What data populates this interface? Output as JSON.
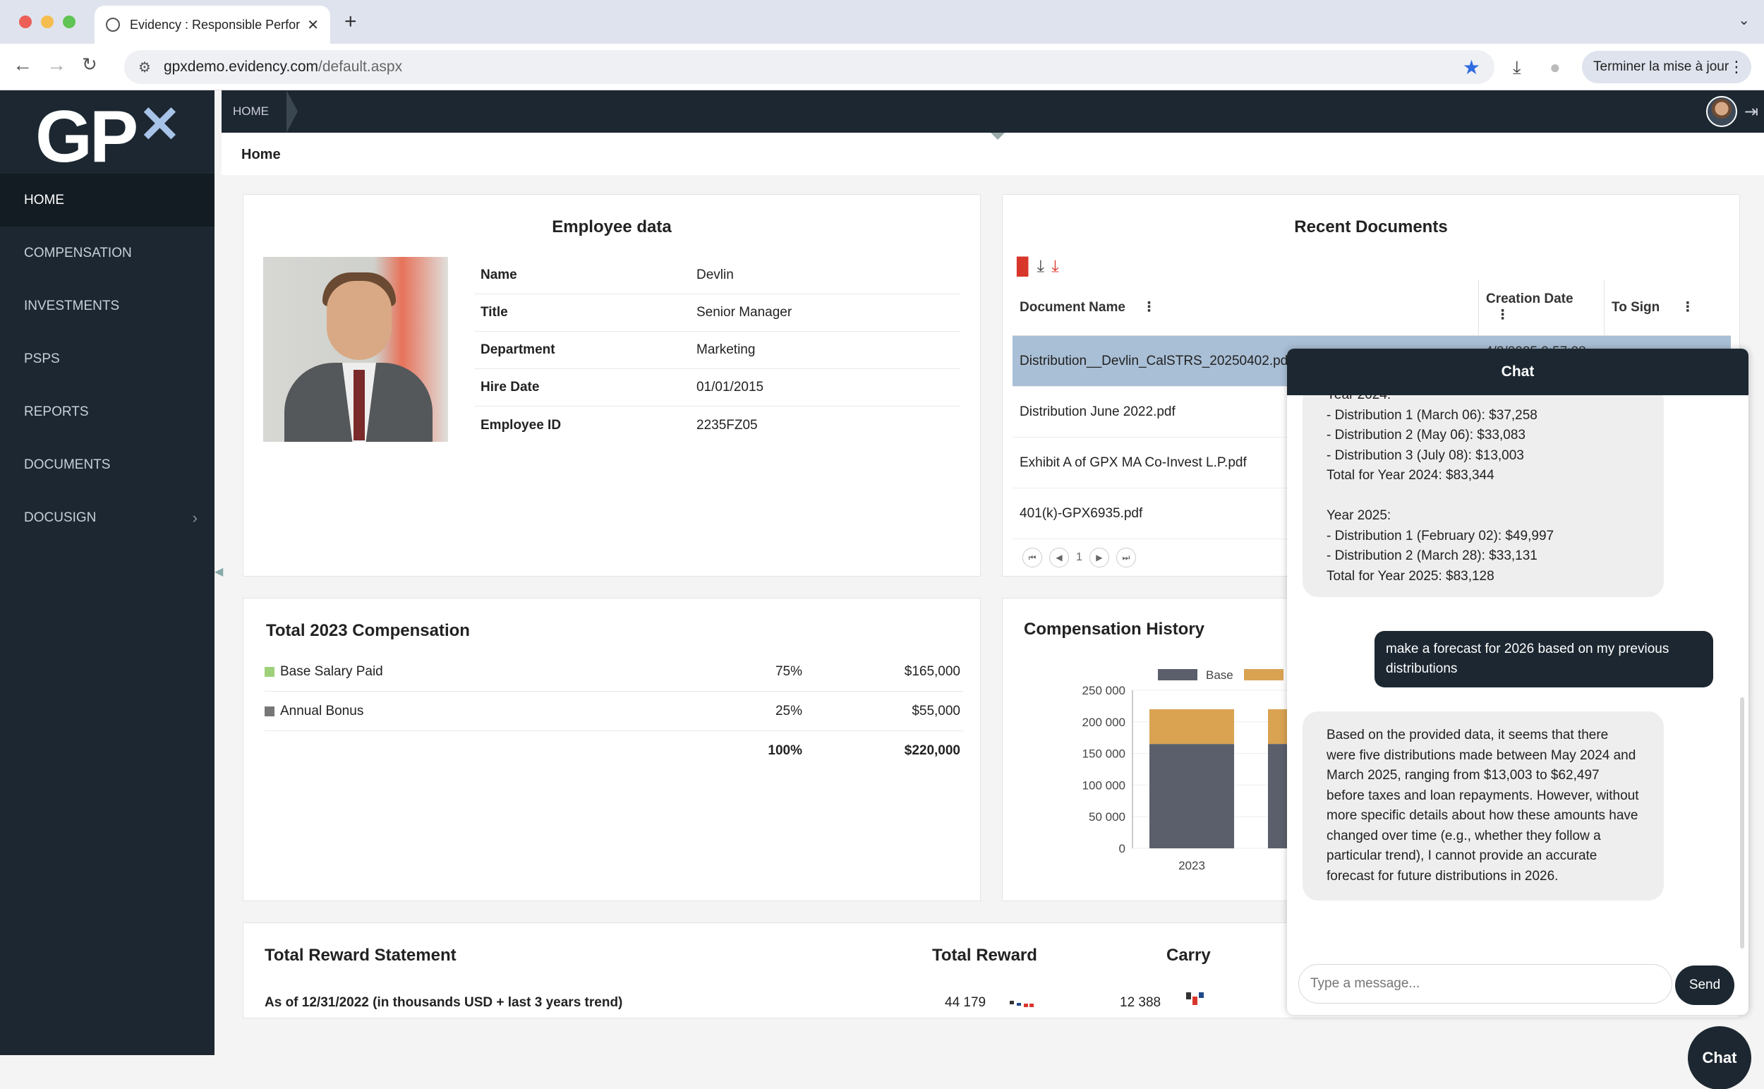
{
  "browser": {
    "tab_title": "Evidency : Responsible Perfor",
    "tab_close": "✕",
    "new_tab": "+",
    "url_host": "gpxdemo.evidency.com",
    "url_path": "/default.aspx",
    "update_button": "Terminer la mise à jour",
    "traffic_lights": [
      "#ec5f57",
      "#f5bd4f",
      "#5fc453"
    ]
  },
  "app": {
    "logo_text": "GP",
    "logo_mark": "✕",
    "breadcrumb": "HOME",
    "page_title": "Home"
  },
  "sidebar": {
    "items": [
      {
        "label": "HOME"
      },
      {
        "label": "COMPENSATION"
      },
      {
        "label": "INVESTMENTS"
      },
      {
        "label": "PSPS"
      },
      {
        "label": "REPORTS"
      },
      {
        "label": "DOCUMENTS"
      },
      {
        "label": "DOCUSIGN"
      }
    ]
  },
  "employee": {
    "title": "Employee data",
    "fields": [
      {
        "label": "Name",
        "value": "Devlin"
      },
      {
        "label": "Title",
        "value": "Senior Manager"
      },
      {
        "label": "Department",
        "value": "Marketing"
      },
      {
        "label": "Hire Date",
        "value": "01/01/2015"
      },
      {
        "label": "Employee ID",
        "value": "2235FZ05"
      }
    ]
  },
  "documents": {
    "title": "Recent Documents",
    "col_name": "Document Name",
    "col_date": "Creation Date",
    "col_sign": "To Sign",
    "rows": [
      {
        "name": "Distribution__Devlin_CalSTRS_20250402.pdf",
        "date": "4/2/2025 9:57:28"
      },
      {
        "name": "Distribution June 2022.pdf",
        "date": ""
      },
      {
        "name": "Exhibit A of GPX MA Co-Invest L.P.pdf",
        "date": ""
      },
      {
        "name": "401(k)-GPX6935.pdf",
        "date": ""
      }
    ],
    "page": "1"
  },
  "compensation": {
    "title": "Total 2023 Compensation",
    "rows": [
      {
        "label": "Base Salary Paid",
        "pct": "75%",
        "amount": "$165,000",
        "color": "#9fd07a"
      },
      {
        "label": "Annual Bonus",
        "pct": "25%",
        "amount": "$55,000",
        "color": "#777777"
      }
    ],
    "total_pct": "100%",
    "total_amount": "$220,000"
  },
  "history": {
    "title": "Compensation History"
  },
  "chart_data": {
    "type": "bar",
    "categories": [
      "2023"
    ],
    "series": [
      {
        "name": "Base",
        "values": [
          165000
        ],
        "color": "#5a5f6b"
      },
      {
        "name": "",
        "values": [
          55000
        ],
        "color": "#d9a352"
      }
    ],
    "ylim": [
      0,
      250000
    ],
    "yticks": [
      "250 000",
      "200 000",
      "150 000",
      "100 000",
      "50 000",
      "0"
    ],
    "stacked": true,
    "legend": "top"
  },
  "reward": {
    "title": "Total Reward Statement",
    "col_total": "Total Reward",
    "col_carry": "Carry",
    "subtitle": "As of 12/31/2022 (in thousands USD + last 3 years trend)",
    "total_value": "44 179",
    "carry_value": "12 388"
  },
  "chat": {
    "header": "Chat",
    "bot_msg_1_lines": [
      "Year 2024:",
      "- Distribution 1 (March 06): $37,258",
      "- Distribution 2 (May 06): $33,083",
      "- Distribution 3 (July 08): $13,003",
      "Total for Year 2024: $83,344",
      "",
      "Year 2025:",
      "- Distribution 1 (February 02): $49,997",
      "- Distribution 2 (March 28): $33,131",
      "Total for Year 2025: $83,128"
    ],
    "user_msg": "make a forecast for 2026 based on my previous distributions",
    "bot_msg_2": "Based on the provided data, it seems that there were five distributions made between May 2024 and March 2025, ranging from $13,003 to $62,497 before taxes and loan repayments. However, without more specific details about how these amounts have changed over time (e.g., whether they follow a particular trend), I cannot provide an accurate forecast for future distributions in 2026.",
    "input_placeholder": "Type a message...",
    "send_label": "Send",
    "fab_label": "Chat"
  }
}
